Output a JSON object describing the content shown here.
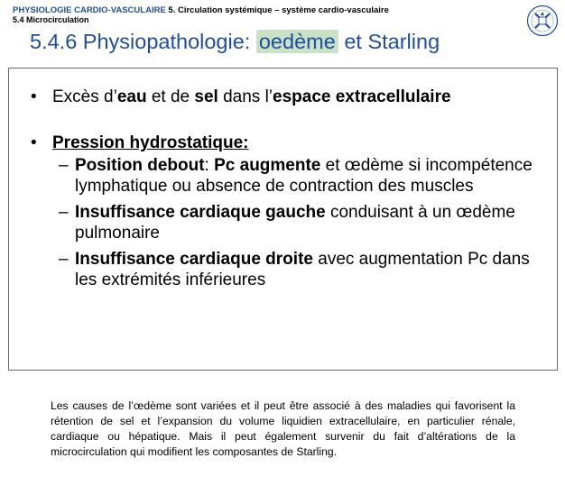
{
  "header": {
    "course": "PHYSIOLOGIE CARDIO-VASCULAIRE",
    "chapter": "5. Circulation systémique – système cardio-vasculaire",
    "section": "5.4 Microcirculation"
  },
  "logo": {
    "icon": "university-seal-icon",
    "color": "#1f4e9c"
  },
  "title": {
    "prefix": "5.4.6 Physiopathologie: ",
    "highlight": "oedème",
    "suffix": " et Starling",
    "color": "#1f4e9c",
    "highlight_color": "#c9e2c6"
  },
  "bullets": {
    "b1": {
      "t1": "Excès d’",
      "b1": "eau",
      "t2": " et de ",
      "b2": "sel",
      "t3": " dans l’",
      "b3": "espace extracellulaire"
    },
    "b2": {
      "heading": "Pression hydrostatique:"
    },
    "s1": {
      "b1": "Position debout",
      "t1": ": ",
      "b2": "Pc augmente",
      "t2": " et œdème si incompétence lymphatique ou absence de contraction des muscles"
    },
    "s2": {
      "b1": "Insuffisance cardiaque gauche",
      "t1": " conduisant à un œdème pulmonaire"
    },
    "s3": {
      "b1": "Insuffisance cardiaque droite",
      "t1": " avec augmentation Pc dans les extrémités inférieures"
    }
  },
  "caption": "Les causes de l’œdème sont variées et il peut être associé à des maladies qui favorisent la rétention de sel et l’expansion du volume liquidien extracellulaire, en particulier rénale, cardiaque ou hépatique. Mais il peut également survenir du fait d’altérations de la microcirculation qui modifient les composantes de Starling."
}
